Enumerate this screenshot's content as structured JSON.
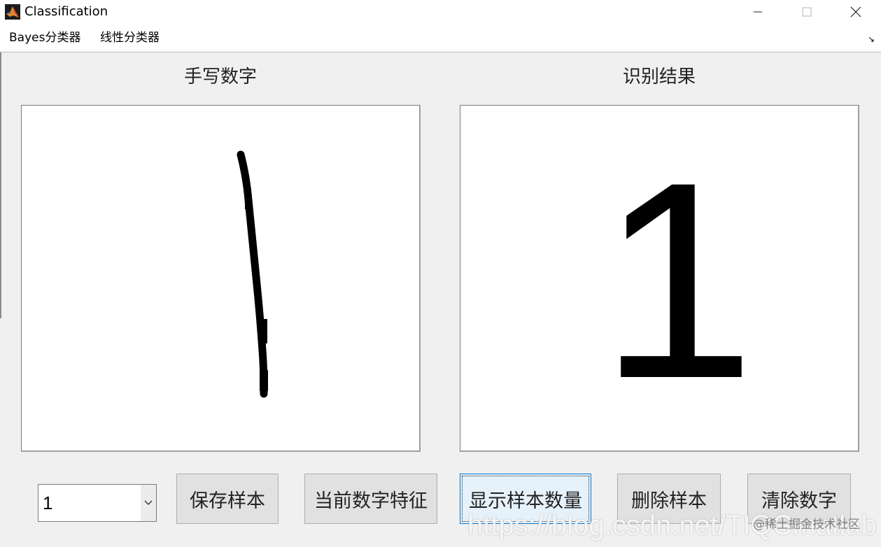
{
  "window": {
    "title": "Classification",
    "icon": "matlab-icon"
  },
  "window_controls": {
    "minimize_icon": "minimize-icon",
    "maximize_icon": "maximize-icon",
    "close_icon": "close-icon"
  },
  "menu": {
    "items": [
      {
        "label": "Bayes分类器"
      },
      {
        "label": "线性分类器"
      }
    ],
    "overflow_icon": "corner-arrow-icon",
    "overflow_glyph": "↘"
  },
  "panels": {
    "left_title": "手写数字",
    "right_title": "识别结果"
  },
  "result": {
    "digit": "1"
  },
  "controls": {
    "select_value": "1",
    "select_arrow_icon": "chevron-down-icon",
    "buttons": [
      {
        "label": "保存样本"
      },
      {
        "label": "当前数字特征"
      },
      {
        "label": "显示样本数量"
      },
      {
        "label": "删除样本"
      },
      {
        "label": "清除数字"
      }
    ]
  },
  "watermark": {
    "url": "https://blog.csdn.net/TIQCmatlab",
    "source": "@稀土掘金技术社区"
  },
  "colors": {
    "background": "#f0f0f0",
    "canvas": "#ffffff",
    "button": "#e1e1e1",
    "button_focused": "#e5f1fb",
    "focus_border": "#0078d7",
    "ink": "#000000"
  }
}
